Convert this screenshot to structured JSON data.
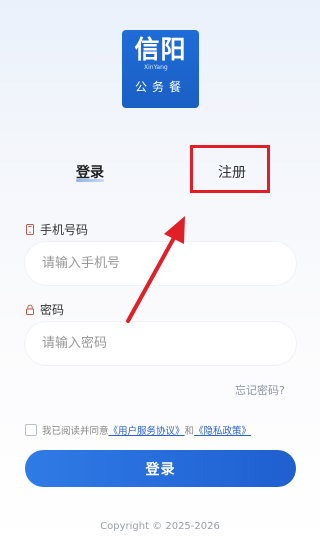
{
  "logo": {
    "title": "信阳",
    "pinyin": "XinYang",
    "subtitle": "公务餐"
  },
  "tabs": {
    "login": "登录",
    "register": "注册"
  },
  "phone": {
    "label": "手机号码",
    "placeholder": "请输入手机号"
  },
  "password": {
    "label": "密码",
    "placeholder": "请输入密码"
  },
  "forgot": "忘记密码?",
  "agreement": {
    "prefix": "我已阅读并同意",
    "user_agreement": "《用户服务协议》",
    "and": "和",
    "privacy": "《隐私政策》"
  },
  "login_button": "登录",
  "copyright": "Copyright © 2025-2026",
  "colors": {
    "primary": "#1f5fd0",
    "annotation": "#e01f26"
  }
}
